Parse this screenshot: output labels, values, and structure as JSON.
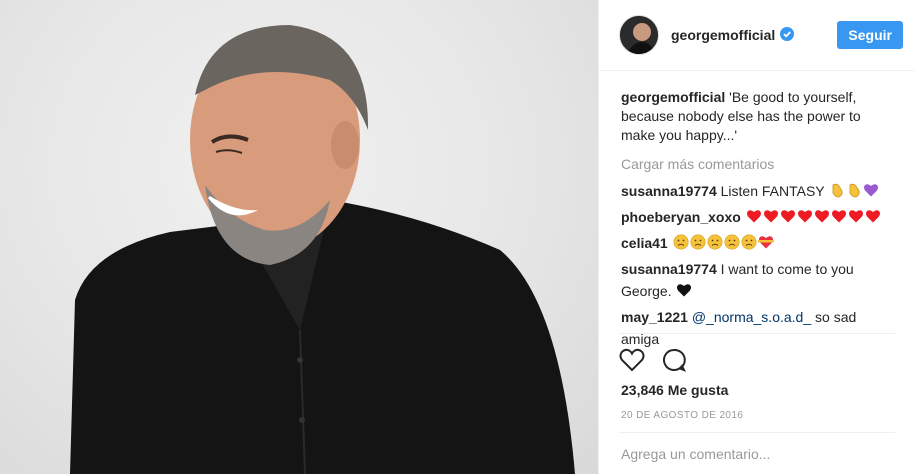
{
  "post": {
    "photo_alt": "",
    "author": "georgemofficial",
    "follow_label": "Seguir",
    "caption_user": "georgemofficial",
    "caption_text": " 'Be good to yourself, because nobody else has the power to make you happy...'",
    "load_more": "Cargar más comentarios",
    "comments": [
      {
        "user": "susanna19774",
        "text": " Listen FANTASY ",
        "emojis": [
          "clap",
          "clap",
          "purple-heart"
        ]
      },
      {
        "user": "phoeberyan_xoxo",
        "text": " ",
        "emojis": [
          "red-heart",
          "red-heart",
          "red-heart",
          "red-heart",
          "red-heart",
          "red-heart",
          "red-heart",
          "red-heart"
        ]
      },
      {
        "user": "celia41",
        "text": " ",
        "emojis": [
          "sad-face",
          "crying-face",
          "weary-face",
          "disappointed-face",
          "tired-face",
          "heart-ribbon"
        ]
      },
      {
        "user": "susanna19774",
        "text": " I want to come to you George. ",
        "emojis": [
          "black-heart"
        ]
      },
      {
        "user": "may_1221",
        "mention": "@_norma_s.o.a.d_",
        "text": " so sad amiga",
        "emojis": []
      }
    ],
    "likes": "23,846 Me gusta",
    "date": "20 DE AGOSTO DE 2016",
    "add_comment_placeholder": "Agrega un comentario..."
  },
  "colors": {
    "accent": "#3897f0",
    "verified": "#3897f0",
    "heart": "#ed1c24",
    "purple": "#9b59d0",
    "emoji_yellow": "#f5c33b"
  }
}
